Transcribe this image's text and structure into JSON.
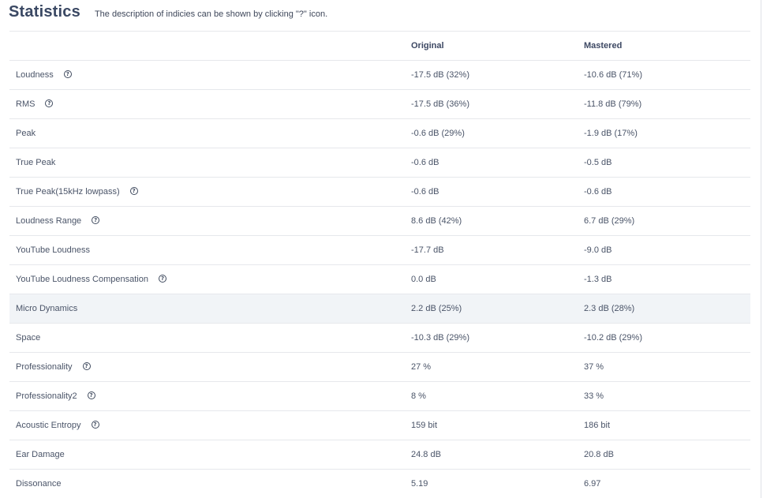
{
  "header": {
    "title": "Statistics",
    "description": "The description of indicies can be shown by clicking \"?\" icon."
  },
  "table": {
    "columns": [
      "",
      "Original",
      "Mastered"
    ],
    "help_glyph": "?",
    "rows": [
      {
        "label": "Loudness",
        "has_help": true,
        "original": "-17.5 dB (32%)",
        "mastered": "-10.6 dB (71%)"
      },
      {
        "label": "RMS",
        "has_help": true,
        "original": "-17.5 dB (36%)",
        "mastered": "-11.8 dB (79%)"
      },
      {
        "label": "Peak",
        "has_help": false,
        "original": "-0.6 dB (29%)",
        "mastered": "-1.9 dB (17%)"
      },
      {
        "label": "True Peak",
        "has_help": false,
        "original": "-0.6 dB",
        "mastered": "-0.5 dB"
      },
      {
        "label": "True Peak(15kHz lowpass)",
        "has_help": true,
        "original": "-0.6 dB",
        "mastered": "-0.6 dB"
      },
      {
        "label": "Loudness Range",
        "has_help": true,
        "original": "8.6 dB (42%)",
        "mastered": "6.7 dB (29%)"
      },
      {
        "label": "YouTube Loudness",
        "has_help": false,
        "original": "-17.7 dB",
        "mastered": "-9.0 dB"
      },
      {
        "label": "YouTube Loudness Compensation",
        "has_help": true,
        "original": "0.0 dB",
        "mastered": "-1.3 dB"
      },
      {
        "label": "Micro Dynamics",
        "has_help": false,
        "original": "2.2 dB (25%)",
        "mastered": "2.3 dB (28%)",
        "highlighted": true
      },
      {
        "label": "Space",
        "has_help": false,
        "original": "-10.3 dB (29%)",
        "mastered": "-10.2 dB (29%)"
      },
      {
        "label": "Professionality",
        "has_help": true,
        "original": "27 %",
        "mastered": "37 %"
      },
      {
        "label": "Professionality2",
        "has_help": true,
        "original": "8 %",
        "mastered": "33 %"
      },
      {
        "label": "Acoustic Entropy",
        "has_help": true,
        "original": "159 bit",
        "mastered": "186 bit"
      },
      {
        "label": "Ear Damage",
        "has_help": false,
        "original": "24.8 dB",
        "mastered": "20.8 dB"
      },
      {
        "label": "Dissonance",
        "has_help": false,
        "original": "5.19",
        "mastered": "6.97"
      }
    ]
  }
}
